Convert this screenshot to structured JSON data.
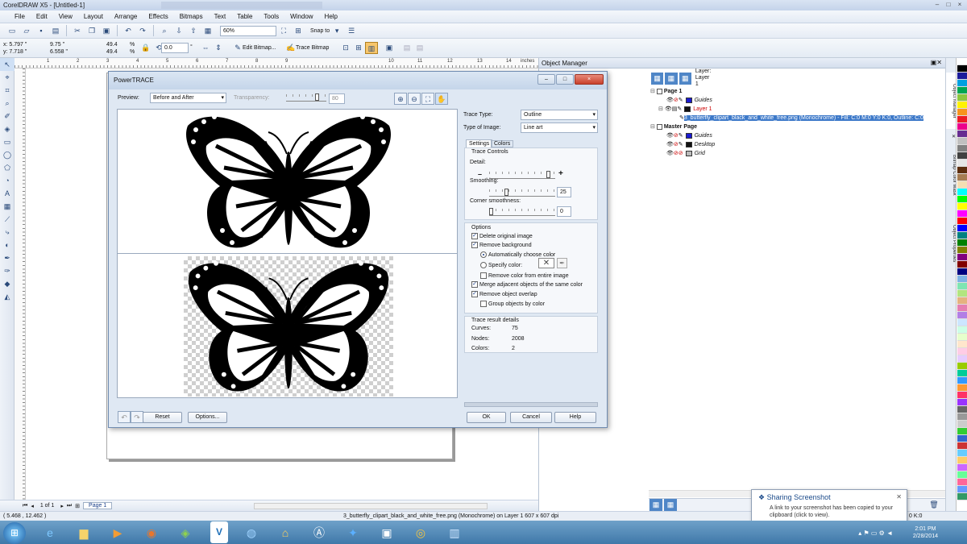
{
  "app": {
    "title": "CorelDRAW X5 - [Untitled-1]",
    "window_controls": [
      "–",
      "□",
      "×"
    ]
  },
  "menu": [
    "File",
    "Edit",
    "View",
    "Layout",
    "Arrange",
    "Effects",
    "Bitmaps",
    "Text",
    "Table",
    "Tools",
    "Window",
    "Help"
  ],
  "standard_toolbar": {
    "zoom": "60%",
    "snap_to": "Snap to"
  },
  "property_bar": {
    "x": "x: 5.797 \"",
    "y": "y: 7.718 \"",
    "w": "9.75 \"",
    "h": "6.558 \"",
    "scale_w": "49.4",
    "scale_h": "49.4",
    "pct1": "%",
    "pct2": "%",
    "rotation": "0.0",
    "rot_unit": "°",
    "edit_bitmap": "Edit Bitmap...",
    "trace_bitmap": "Trace Bitmap"
  },
  "ruler": {
    "units": "inches",
    "ticks": [
      "1",
      "2",
      "3",
      "4",
      "5",
      "6",
      "7",
      "8",
      "9",
      "10",
      "11",
      "12",
      "13",
      "14"
    ]
  },
  "document_nav": {
    "page_count": "1 of 1",
    "page_tab": "Page 1"
  },
  "status": {
    "coords": "( 5.468 , 12.462 )",
    "object_info": "3_butterfly_clipart_black_and_white_free.png (Monochrome) on Layer 1 607 x 607 dpi",
    "color_info": "0 K:0"
  },
  "powertrace": {
    "title": "PowerTRACE",
    "preview_label": "Preview:",
    "preview_value": "Before and After",
    "transparency_label": "Transparency:",
    "transparency_value": "80",
    "trace_type_label": "Trace Type:",
    "trace_type_value": "Outline",
    "image_type_label": "Type of Image:",
    "image_type_value": "Line art",
    "tabs": [
      "Settings",
      "Colors"
    ],
    "trace_controls_label": "Trace Controls",
    "detail_label": "Detail:",
    "smoothing_label": "Smoothing:",
    "smoothing_value": "25",
    "corner_label": "Corner smoothness:",
    "corner_value": "0",
    "sliders": {
      "detail": 0.92,
      "smoothing": 0.25,
      "corner": 0.0
    },
    "options_label": "Options",
    "opt_delete_original": "Delete original image",
    "opt_remove_background": "Remove background",
    "opt_auto_color": "Automatically choose color",
    "opt_specify_color": "Specify color:",
    "opt_remove_entire": "Remove color from entire image",
    "opt_merge": "Merge adjacent objects of the same color",
    "opt_overlap": "Remove object overlap",
    "opt_group": "Group objects by color",
    "details_label": "Trace result details",
    "curves_label": "Curves:",
    "curves_value": "75",
    "nodes_label": "Nodes:",
    "nodes_value": "2008",
    "colors_label": "Colors:",
    "colors_value": "2",
    "reset": "Reset",
    "options": "Options...",
    "ok": "OK",
    "cancel": "Cancel",
    "help": "Help"
  },
  "object_manager": {
    "title": "Object Manager",
    "layer_caption": "Layer:",
    "layer_name": "Layer 1",
    "page1": "Page 1",
    "guides": "Guides",
    "layer1": "Layer 1",
    "object": "3_butterfly_clipart_black_and_white_free.png (Monochrome) - Fill: C:0 M:0 Y:0 K:0, Outline: C:0",
    "master_page": "Master Page",
    "m_guides": "Guides",
    "m_desktop": "Desktop",
    "m_grid": "Grid"
  },
  "docker_tabs": [
    "Object Manager",
    "Bitmap Color Mask",
    "Object Properties"
  ],
  "toast": {
    "title": "Sharing Screenshot",
    "body": "A link to your screenshot has been copied to your clipboard (click to view)."
  },
  "clock": {
    "time": "2:01 PM",
    "date": "2/28/2014"
  },
  "palette_colors": [
    "#ffffff",
    "#000000",
    "#1b1b9b",
    "#00a0e0",
    "#00a651",
    "#8dc63f",
    "#fff200",
    "#f7941d",
    "#ed1c24",
    "#ec008c",
    "#662d91",
    "#c0c0c0",
    "#808080",
    "#404040",
    "#e6e6e6",
    "#5c2d0e",
    "#a67c52",
    "#f5deb3",
    "#00ffff",
    "#00ff00",
    "#ffff00",
    "#ff00ff",
    "#ff0000",
    "#0000ff",
    "#008080",
    "#008000",
    "#808000",
    "#800080",
    "#800000",
    "#000080",
    "#7fb2e5",
    "#7fe5b2",
    "#b2e57f",
    "#e5b27f",
    "#e57fb2",
    "#b27fe5",
    "#cce6ff",
    "#ccffe6",
    "#e6ffcc",
    "#ffe6cc",
    "#ffcce6",
    "#e6ccff",
    "#99cc00",
    "#00cc99",
    "#3399ff",
    "#ff9933",
    "#ff3366",
    "#9933ff",
    "#666666",
    "#999999",
    "#cccccc",
    "#33cc33",
    "#3366cc",
    "#cc3333",
    "#66ccff",
    "#ffcc66",
    "#cc66ff",
    "#66ff99",
    "#ff6699",
    "#6699ff",
    "#339966"
  ]
}
